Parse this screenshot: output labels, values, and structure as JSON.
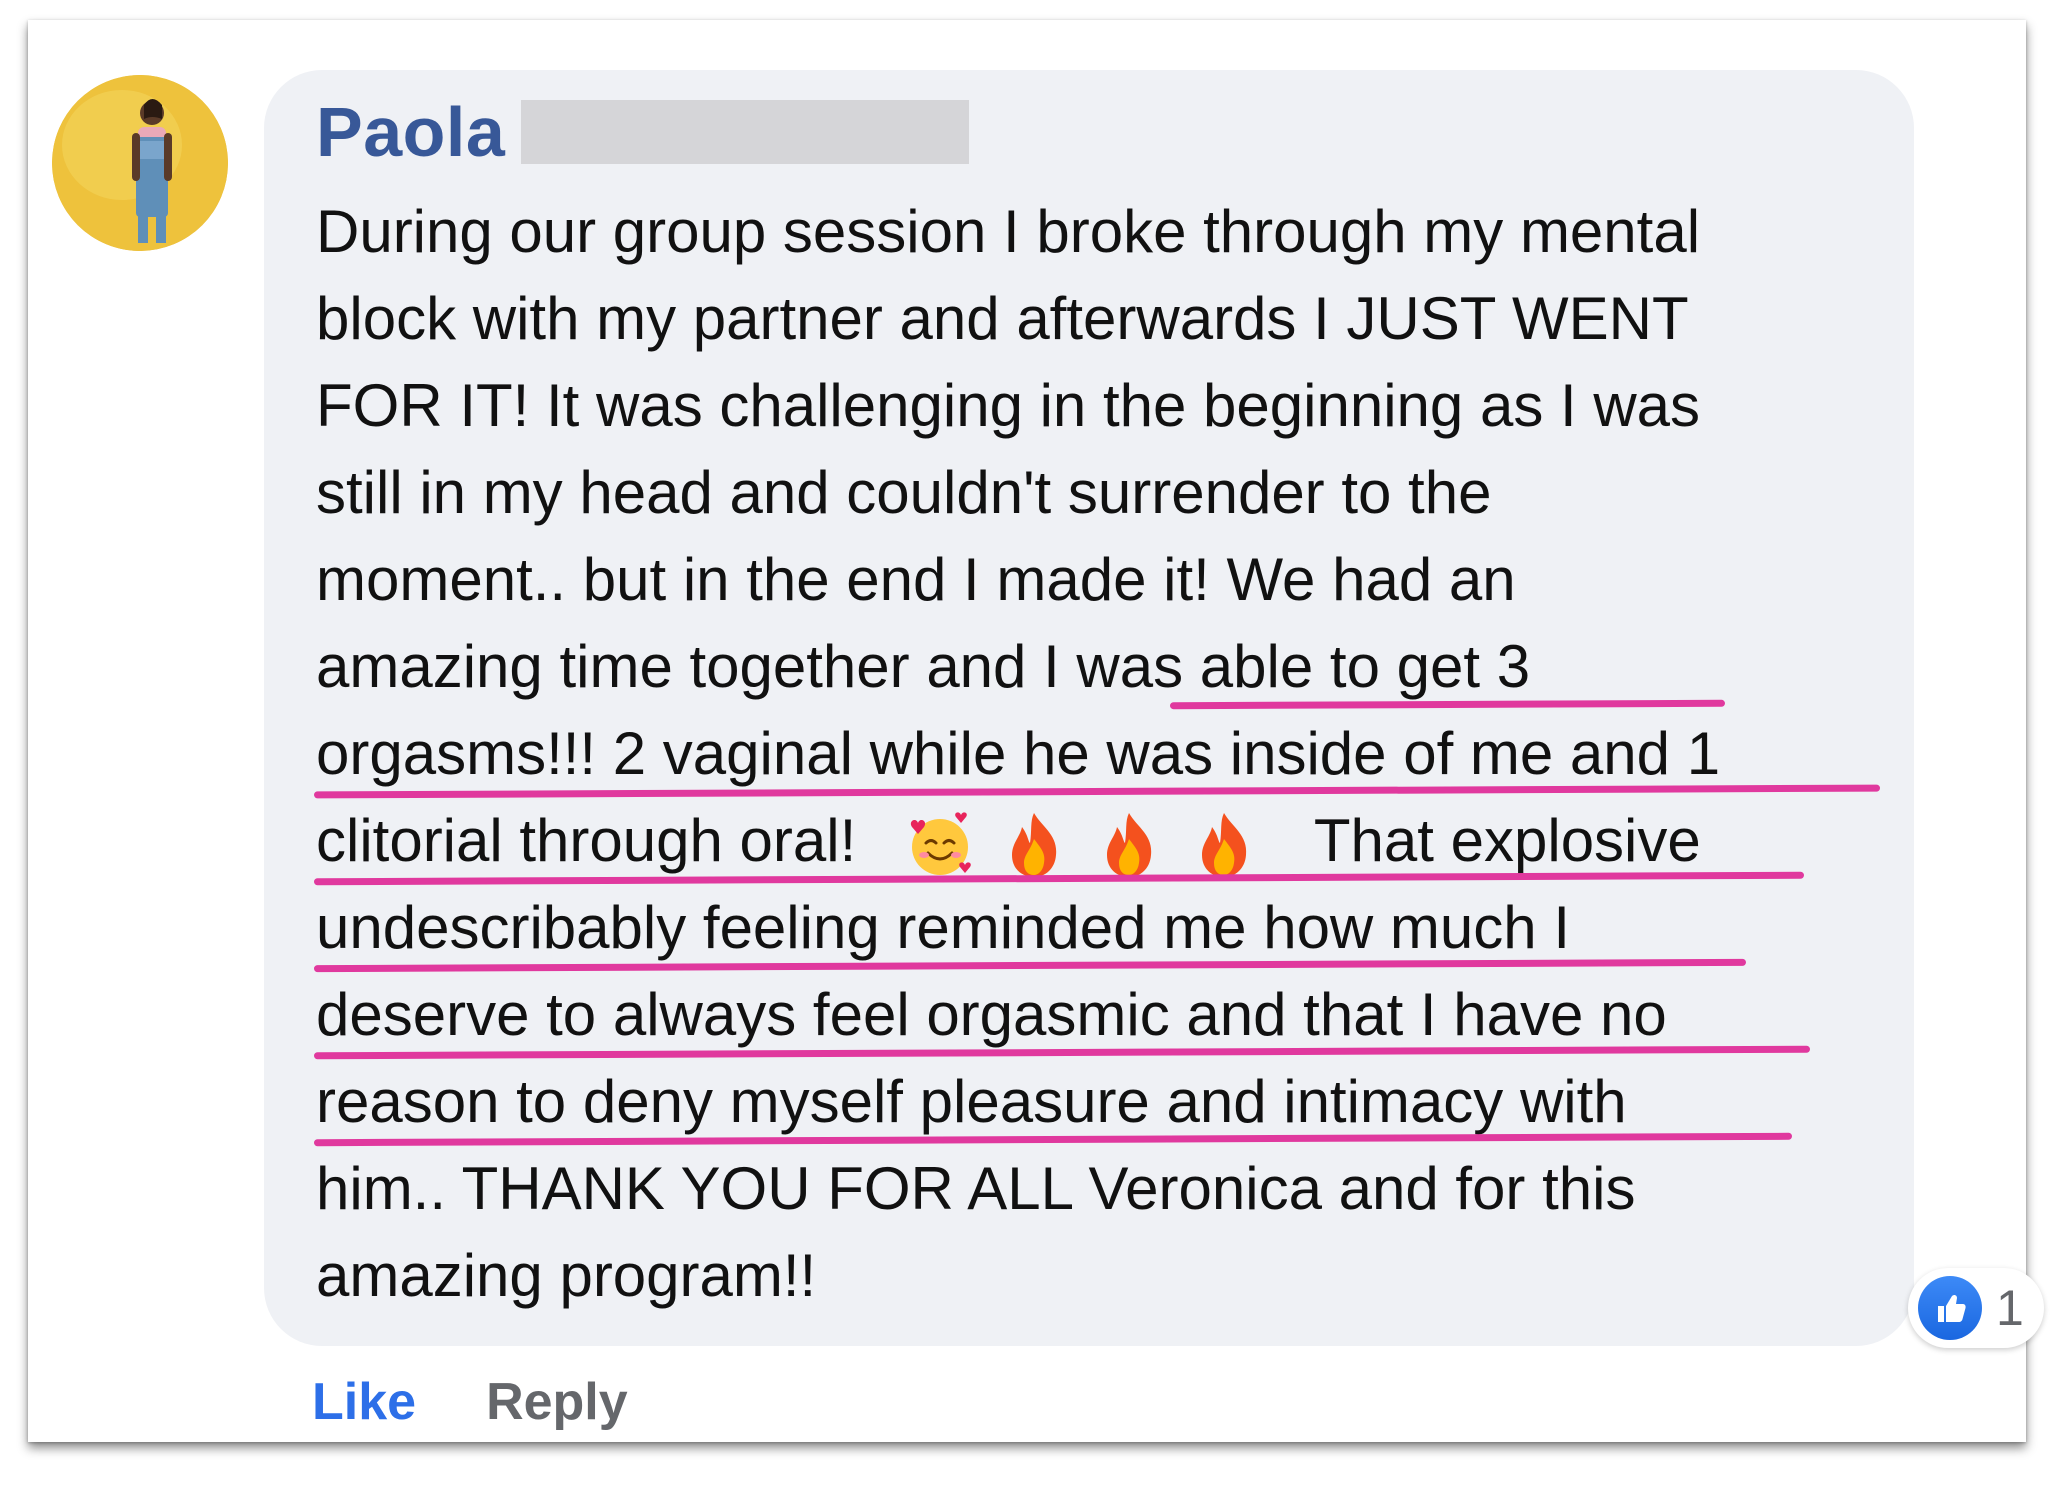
{
  "comment": {
    "author": "Paola",
    "lines": [
      "During our group session I broke through my mental",
      "block with my partner and afterwards I JUST WENT",
      "FOR IT! It was challenging in the beginning as I was",
      "still in my head and couldn't surrender to the",
      "moment.. but in the end I made it! We had an",
      "amazing time together and I was able to get 3",
      "orgasms!!! 2 vaginal while he was inside of me and 1",
      "clitorial through oral!",
      "That explosive",
      "undescribably feeling reminded me how much I",
      "deserve to always feel orgasmic and that I have no",
      "reason to deny myself pleasure and intimacy with",
      "him.. THANK YOU FOR ALL Veronica and for this",
      "amazing program!!"
    ],
    "emojis": [
      "smiling-face-with-hearts-icon",
      "fire-icon",
      "fire-icon",
      "fire-icon"
    ],
    "highlight_color": "#e0399e"
  },
  "reactions": {
    "type": "like-icon",
    "count": "1"
  },
  "actions": {
    "like_label": "Like",
    "reply_label": "Reply"
  },
  "colors": {
    "name": "#385898",
    "like": "#2d6fe8",
    "reply": "#65676b",
    "bubble": "#eff1f5"
  }
}
